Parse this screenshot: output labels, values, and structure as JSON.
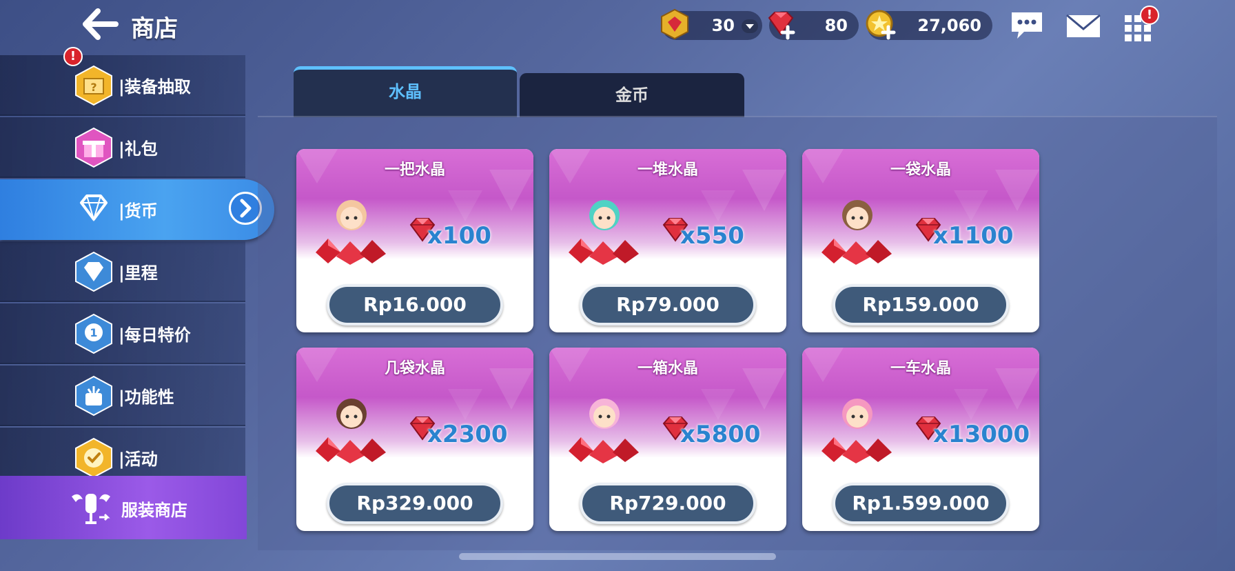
{
  "header": {
    "title": "商店",
    "back_icon": "arrow-left-icon"
  },
  "currencies": {
    "stamina": {
      "value": "30",
      "icon": "gem-badge-icon"
    },
    "gems": {
      "value": "80",
      "icon": "red-gem-plus-icon"
    },
    "gold": {
      "value": "27,060",
      "icon": "gold-coin-plus-icon"
    }
  },
  "top_icons": {
    "chat": "chat-bubble-icon",
    "mail": "mail-icon",
    "menu": "grid-menu-icon",
    "menu_alert": "!"
  },
  "sidebar": {
    "items": [
      {
        "label": "装备抽取",
        "icon": "mystery-box-icon",
        "alert": "!"
      },
      {
        "label": "礼包",
        "icon": "gift-icon"
      },
      {
        "label": "货币",
        "icon": "diamond-icon",
        "active": true
      },
      {
        "label": "里程",
        "icon": "mileage-diamond-icon"
      },
      {
        "label": "每日特价",
        "icon": "daily-badge-icon"
      },
      {
        "label": "功能性",
        "icon": "function-icon"
      },
      {
        "label": "活动",
        "icon": "event-check-icon"
      }
    ],
    "bottom": {
      "label": "服装商店",
      "icon": "costume-shop-icon"
    }
  },
  "tabs": [
    {
      "label": "水晶",
      "active": true
    },
    {
      "label": "金币",
      "active": false
    }
  ],
  "cards": [
    {
      "title": "一把水晶",
      "amount": "x100",
      "price": "Rp16.000"
    },
    {
      "title": "一堆水晶",
      "amount": "x550",
      "price": "Rp79.000"
    },
    {
      "title": "一袋水晶",
      "amount": "x1100",
      "price": "Rp159.000"
    },
    {
      "title": "几袋水晶",
      "amount": "x2300",
      "price": "Rp329.000"
    },
    {
      "title": "一箱水晶",
      "amount": "x5800",
      "price": "Rp729.000"
    },
    {
      "title": "一车水晶",
      "amount": "x13000",
      "price": "Rp1.599.000"
    }
  ],
  "colors": {
    "accent_blue": "#5ec0ff",
    "active_sidebar": "#3a8be6",
    "costume_purple": "#8247d8",
    "card_pink": "#c558c9",
    "price_button": "#3f5a7a",
    "amount_blue": "#2a83cf"
  }
}
